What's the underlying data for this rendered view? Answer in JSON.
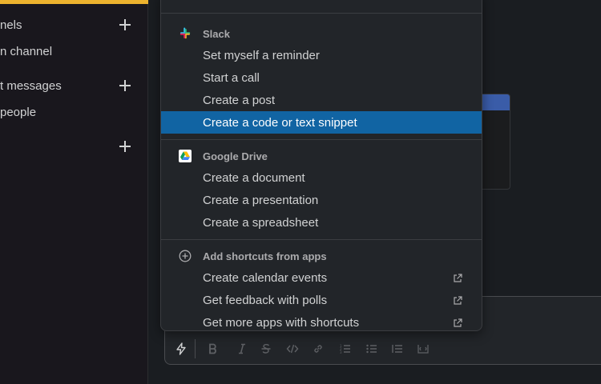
{
  "sidebar": {
    "channels_label": "nels",
    "add_channel_label": "n channel",
    "direct_messages_label": "t messages",
    "add_people_label": " people"
  },
  "menu": {
    "slack": {
      "title": "Slack",
      "items": [
        "Set myself a reminder",
        "Start a call",
        "Create a post",
        "Create a code or text snippet"
      ],
      "selected_index": 3
    },
    "google_drive": {
      "title": "Google Drive",
      "items": [
        "Create a document",
        "Create a presentation",
        "Create a spreadsheet"
      ]
    },
    "apps": {
      "title": "Add shortcuts from apps",
      "items": [
        "Create calendar events",
        "Get feedback with polls",
        "Get more apps with shortcuts"
      ]
    }
  },
  "composer_toolbar": {
    "icons": [
      "lightning-icon",
      "bold-icon",
      "italic-icon",
      "strikethrough-icon",
      "code-icon",
      "link-icon",
      "ordered-list-icon",
      "bulleted-list-icon",
      "blockquote-icon",
      "code-block-icon"
    ]
  },
  "colors": {
    "selected_bg": "#1164a3",
    "workspace_accent": "#ecb22e",
    "sidebar_bg": "#19171d",
    "menu_bg": "#222529"
  }
}
